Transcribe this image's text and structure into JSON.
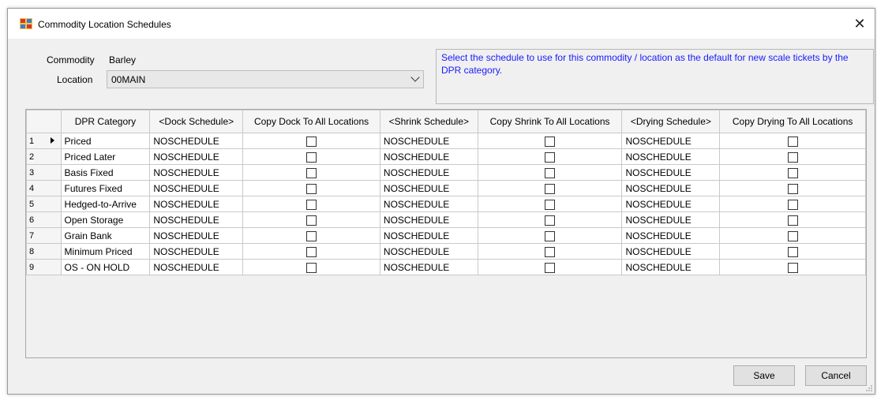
{
  "window": {
    "title": "Commodity Location Schedules",
    "close_label": "✕"
  },
  "form": {
    "commodity_label": "Commodity",
    "commodity_value": "Barley",
    "location_label": "Location",
    "location_value": "00MAIN"
  },
  "hint": "Select the schedule to use for this commodity / location as the default for new scale tickets by the DPR category.",
  "grid": {
    "columns": [
      "",
      "DPR Category",
      "<Dock Schedule>",
      "Copy Dock To All Locations",
      "<Shrink Schedule>",
      "Copy Shrink To All Locations",
      "<Drying Schedule>",
      "Copy Drying To All Locations"
    ],
    "rows": [
      {
        "num": "1",
        "category": "Priced",
        "dock": "NOSCHEDULE",
        "copy_dock": false,
        "shrink": "NOSCHEDULE",
        "copy_shrink": false,
        "drying": "NOSCHEDULE",
        "copy_drying": false,
        "current": true
      },
      {
        "num": "2",
        "category": "Priced Later",
        "dock": "NOSCHEDULE",
        "copy_dock": false,
        "shrink": "NOSCHEDULE",
        "copy_shrink": false,
        "drying": "NOSCHEDULE",
        "copy_drying": false
      },
      {
        "num": "3",
        "category": "Basis Fixed",
        "dock": "NOSCHEDULE",
        "copy_dock": false,
        "shrink": "NOSCHEDULE",
        "copy_shrink": false,
        "drying": "NOSCHEDULE",
        "copy_drying": false
      },
      {
        "num": "4",
        "category": "Futures Fixed",
        "dock": "NOSCHEDULE",
        "copy_dock": false,
        "shrink": "NOSCHEDULE",
        "copy_shrink": false,
        "drying": "NOSCHEDULE",
        "copy_drying": false
      },
      {
        "num": "5",
        "category": "Hedged-to-Arrive",
        "dock": "NOSCHEDULE",
        "copy_dock": false,
        "shrink": "NOSCHEDULE",
        "copy_shrink": false,
        "drying": "NOSCHEDULE",
        "copy_drying": false
      },
      {
        "num": "6",
        "category": "Open Storage",
        "dock": "NOSCHEDULE",
        "copy_dock": false,
        "shrink": "NOSCHEDULE",
        "copy_shrink": false,
        "drying": "NOSCHEDULE",
        "copy_drying": false
      },
      {
        "num": "7",
        "category": "Grain Bank",
        "dock": "NOSCHEDULE",
        "copy_dock": false,
        "shrink": "NOSCHEDULE",
        "copy_shrink": false,
        "drying": "NOSCHEDULE",
        "copy_drying": false
      },
      {
        "num": "8",
        "category": "Minimum Priced",
        "dock": "NOSCHEDULE",
        "copy_dock": false,
        "shrink": "NOSCHEDULE",
        "copy_shrink": false,
        "drying": "NOSCHEDULE",
        "copy_drying": false
      },
      {
        "num": "9",
        "category": "OS - ON HOLD",
        "dock": "NOSCHEDULE",
        "copy_dock": false,
        "shrink": "NOSCHEDULE",
        "copy_shrink": false,
        "drying": "NOSCHEDULE",
        "copy_drying": false
      }
    ]
  },
  "buttons": {
    "save": "Save",
    "cancel": "Cancel"
  },
  "colors": {
    "hint_text": "#1a1aff",
    "window_bg": "#f0f0f0"
  },
  "icons": {
    "app": "window-app-icon",
    "close": "close-icon",
    "dropdown": "chevron-down-icon",
    "current_row": "row-pointer-icon",
    "resize": "resize-grip-icon"
  }
}
